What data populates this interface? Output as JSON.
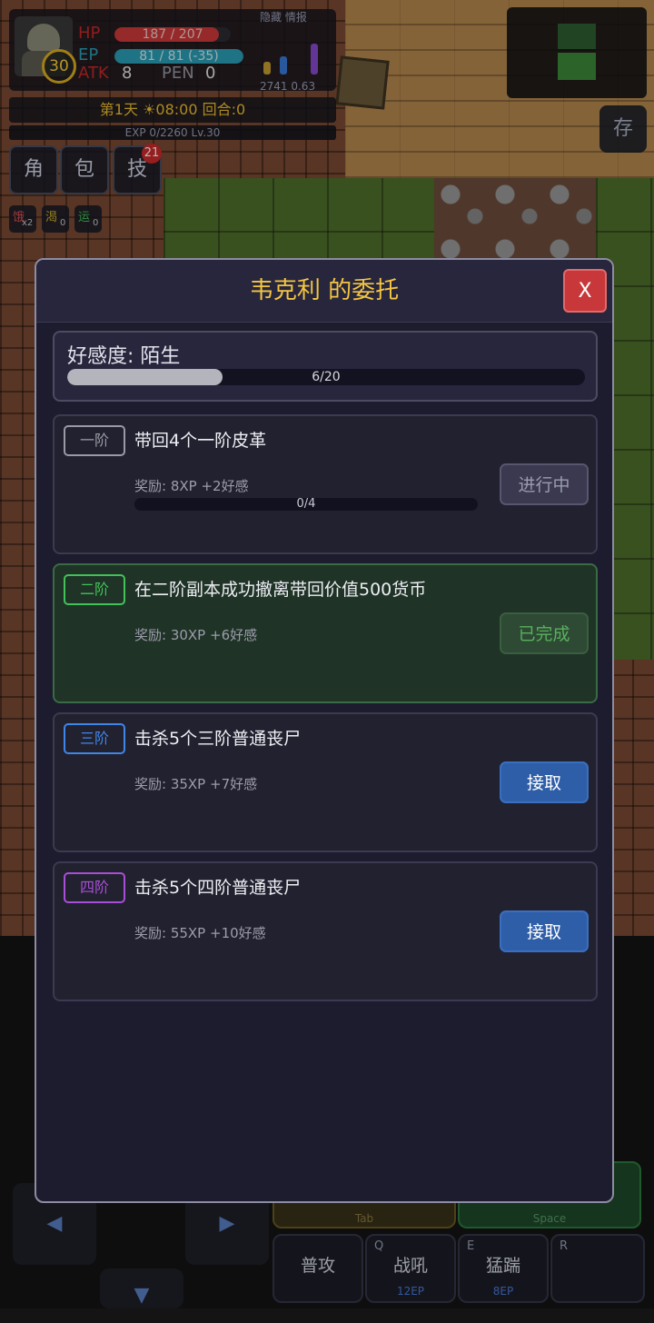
{
  "hud": {
    "level": "30",
    "hp_label": "HP",
    "hp_value": "187 / 207",
    "hp_fraction": 0.9,
    "ep_label": "EP",
    "ep_value": "81 / 81 (-35)",
    "ep_fraction": 1.0,
    "atk_label": "ATK",
    "atk_value": "8",
    "pen_label": "PEN",
    "pen_value": "0",
    "top_right_text": "隐藏 情报",
    "resource_text": "2741 0.63",
    "day_time_turn": "第1天 ☀08:00 回合:0",
    "exp_text": "EXP 0/2260 Lv.30",
    "colors": {
      "hp": "#d03a3a",
      "ep": "#2aa0b8",
      "level_ring": "#e0b020"
    }
  },
  "menu": {
    "character": "角",
    "bag": "包",
    "skills": "技",
    "skills_badge": "21",
    "save": "存"
  },
  "buffs": [
    {
      "icon": "饿",
      "count": "x2"
    },
    {
      "icon": "渴",
      "count": "0"
    },
    {
      "icon": "运",
      "count": "0"
    }
  ],
  "controls": {
    "left_arrow": "◀",
    "right_arrow": "▶",
    "down_arrow": "▼",
    "tab_hint": "Tab",
    "space_hint": "Space",
    "attack": "普攻",
    "skill_q_key": "Q",
    "skill_q": "战吼",
    "skill_q_cost": "12EP",
    "skill_e_key": "E",
    "skill_e": "猛踹",
    "skill_e_cost": "8EP",
    "skill_r_key": "R"
  },
  "dialog": {
    "title": "韦克利 的委托",
    "close_label": "X",
    "affinity_label": "好感度: 陌生",
    "affinity_text": "6/20",
    "affinity_fraction": 0.3,
    "tasks": [
      {
        "tier": "一阶",
        "tier_color": "#9a9aa6",
        "title": "带回4个一阶皮革",
        "reward": "奖励: 8XP +2好感",
        "progress_text": "0/4",
        "button": "进行中",
        "state": "in_progress"
      },
      {
        "tier": "二阶",
        "tier_color": "#43c25a",
        "title": "在二阶副本成功撤离带回价值500货币",
        "reward": "奖励: 30XP +6好感",
        "button": "已完成",
        "state": "completed"
      },
      {
        "tier": "三阶",
        "tier_color": "#3f86e8",
        "title": "击杀5个三阶普通丧尸",
        "reward": "奖励: 35XP +7好感",
        "button": "接取",
        "state": "available"
      },
      {
        "tier": "四阶",
        "tier_color": "#a84fd8",
        "title": "击杀5个四阶普通丧尸",
        "reward": "奖励: 55XP +10好感",
        "button": "接取",
        "state": "available"
      }
    ]
  }
}
